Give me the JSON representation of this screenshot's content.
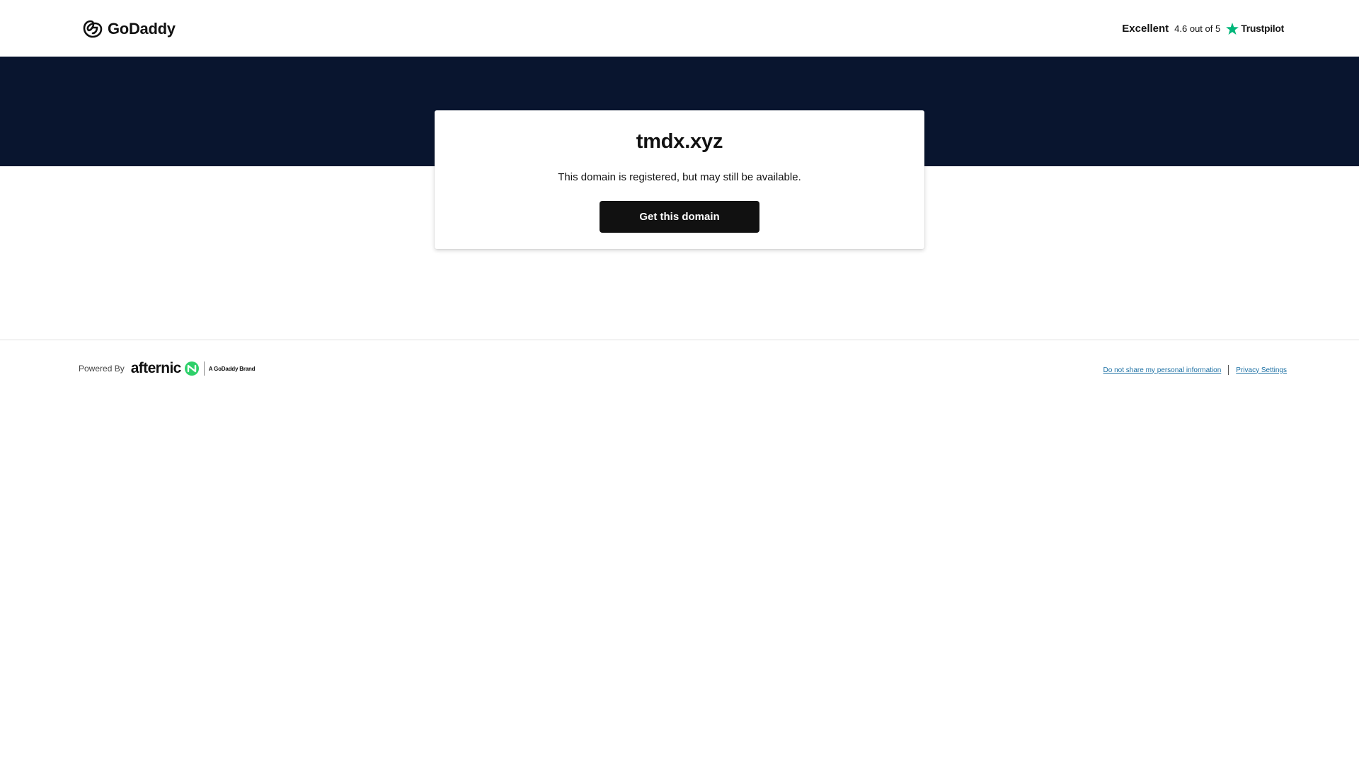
{
  "header": {
    "logo_text": "GoDaddy",
    "rating": {
      "word": "Excellent",
      "score": "4.6 out of 5",
      "provider": "Trustpilot"
    }
  },
  "card": {
    "domain": "tmdx.xyz",
    "status": "This domain is registered, but may still be available.",
    "cta_label": "Get this domain"
  },
  "footer": {
    "powered_by": "Powered By",
    "partner_name": "afternic",
    "partner_tagline": "A GoDaddy Brand",
    "links": {
      "privacy_opt_out": "Do not share my personal information",
      "privacy_settings": "Privacy Settings"
    }
  },
  "colors": {
    "hero_background": "#09152f",
    "button_background": "#111111",
    "trustpilot_green": "#00b67a",
    "afternic_green": "#2ed06a",
    "link": "#1b6fa3"
  },
  "icons": {
    "logo": "godaddy-logo-icon",
    "rating": "trustpilot-star-icon",
    "partner": "afternic-mark-icon"
  }
}
